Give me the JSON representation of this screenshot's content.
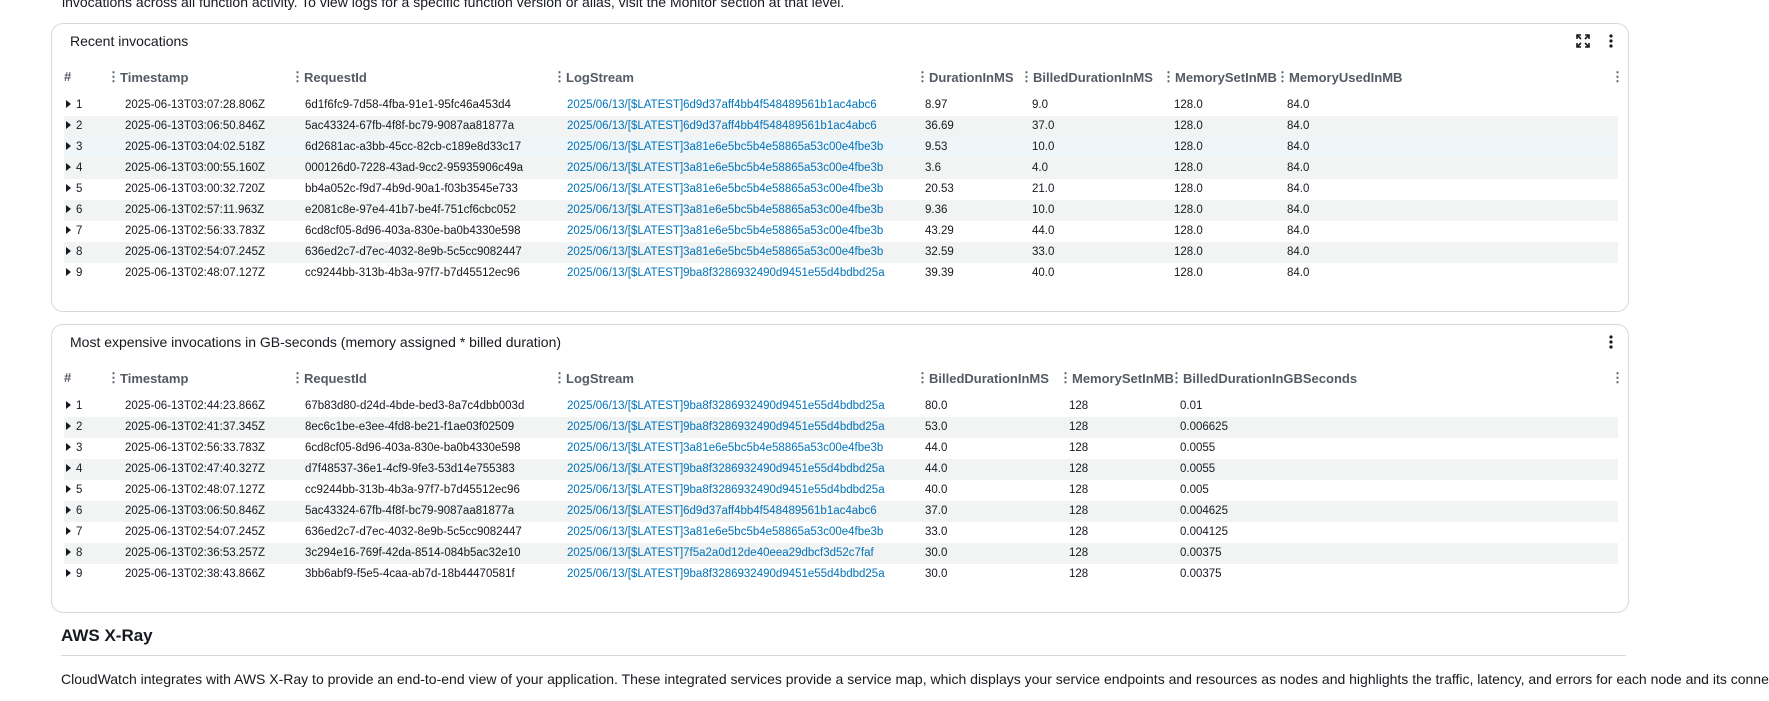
{
  "top_text": "invocations across all function activity. To view logs for a specific function version or alias, visit the Monitor section at that level.",
  "recent": {
    "title": "Recent invocations",
    "columns": [
      "#",
      "Timestamp",
      "RequestId",
      "LogStream",
      "DurationInMS",
      "BilledDurationInMS",
      "MemorySetInMB",
      "MemoryUsedInMB"
    ],
    "rows": [
      [
        "1",
        "2025-06-13T03:07:28.806Z",
        "6d1f6fc9-7d58-4fba-91e1-95fc46a453d4",
        "2025/06/13/[$LATEST]6d9d37aff4bb4f548489561b1ac4abc6",
        "8.97",
        "9.0",
        "128.0",
        "84.0"
      ],
      [
        "2",
        "2025-06-13T03:06:50.846Z",
        "5ac43324-67fb-4f8f-bc79-9087aa81877a",
        "2025/06/13/[$LATEST]6d9d37aff4bb4f548489561b1ac4abc6",
        "36.69",
        "37.0",
        "128.0",
        "84.0"
      ],
      [
        "3",
        "2025-06-13T03:04:02.518Z",
        "6d2681ac-a3bb-45cc-82cb-c189e8d33c17",
        "2025/06/13/[$LATEST]3a81e6e5bc5b4e58865a53c00e4fbe3b",
        "9.53",
        "10.0",
        "128.0",
        "84.0"
      ],
      [
        "4",
        "2025-06-13T03:00:55.160Z",
        "000126d0-7228-43ad-9cc2-95935906c49a",
        "2025/06/13/[$LATEST]3a81e6e5bc5b4e58865a53c00e4fbe3b",
        "3.6",
        "4.0",
        "128.0",
        "84.0"
      ],
      [
        "5",
        "2025-06-13T03:00:32.720Z",
        "bb4a052c-f9d7-4b9d-90a1-f03b3545e733",
        "2025/06/13/[$LATEST]3a81e6e5bc5b4e58865a53c00e4fbe3b",
        "20.53",
        "21.0",
        "128.0",
        "84.0"
      ],
      [
        "6",
        "2025-06-13T02:57:11.963Z",
        "e2081c8e-97e4-41b7-be4f-751cf6cbc052",
        "2025/06/13/[$LATEST]3a81e6e5bc5b4e58865a53c00e4fbe3b",
        "9.36",
        "10.0",
        "128.0",
        "84.0"
      ],
      [
        "7",
        "2025-06-13T02:56:33.783Z",
        "6cd8cf05-8d96-403a-830e-ba0b4330e598",
        "2025/06/13/[$LATEST]3a81e6e5bc5b4e58865a53c00e4fbe3b",
        "43.29",
        "44.0",
        "128.0",
        "84.0"
      ],
      [
        "8",
        "2025-06-13T02:54:07.245Z",
        "636ed2c7-d7ec-4032-8e9b-5c5cc9082447",
        "2025/06/13/[$LATEST]3a81e6e5bc5b4e58865a53c00e4fbe3b",
        "32.59",
        "33.0",
        "128.0",
        "84.0"
      ],
      [
        "9",
        "2025-06-13T02:48:07.127Z",
        "cc9244bb-313b-4b3a-97f7-b7d45512ec96",
        "2025/06/13/[$LATEST]9ba8f3286932490d9451e55d4bdbd25a",
        "39.39",
        "40.0",
        "128.0",
        "84.0"
      ]
    ]
  },
  "expensive": {
    "title": "Most expensive invocations in GB-seconds (memory assigned * billed duration)",
    "columns": [
      "#",
      "Timestamp",
      "RequestId",
      "LogStream",
      "BilledDurationInMS",
      "MemorySetInMB",
      "BilledDurationInGBSeconds"
    ],
    "rows": [
      [
        "1",
        "2025-06-13T02:44:23.866Z",
        "67b83d80-d24d-4bde-bed3-8a7c4dbb003d",
        "2025/06/13/[$LATEST]9ba8f3286932490d9451e55d4bdbd25a",
        "80.0",
        "128",
        "0.01"
      ],
      [
        "2",
        "2025-06-13T02:41:37.345Z",
        "8ec6c1be-e3ee-4fd8-be21-f1ae03f02509",
        "2025/06/13/[$LATEST]9ba8f3286932490d9451e55d4bdbd25a",
        "53.0",
        "128",
        "0.006625"
      ],
      [
        "3",
        "2025-06-13T02:56:33.783Z",
        "6cd8cf05-8d96-403a-830e-ba0b4330e598",
        "2025/06/13/[$LATEST]3a81e6e5bc5b4e58865a53c00e4fbe3b",
        "44.0",
        "128",
        "0.0055"
      ],
      [
        "4",
        "2025-06-13T02:47:40.327Z",
        "d7f48537-36e1-4cf9-9fe3-53d14e755383",
        "2025/06/13/[$LATEST]9ba8f3286932490d9451e55d4bdbd25a",
        "44.0",
        "128",
        "0.0055"
      ],
      [
        "5",
        "2025-06-13T02:48:07.127Z",
        "cc9244bb-313b-4b3a-97f7-b7d45512ec96",
        "2025/06/13/[$LATEST]9ba8f3286932490d9451e55d4bdbd25a",
        "40.0",
        "128",
        "0.005"
      ],
      [
        "6",
        "2025-06-13T03:06:50.846Z",
        "5ac43324-67fb-4f8f-bc79-9087aa81877a",
        "2025/06/13/[$LATEST]6d9d37aff4bb4f548489561b1ac4abc6",
        "37.0",
        "128",
        "0.004625"
      ],
      [
        "7",
        "2025-06-13T02:54:07.245Z",
        "636ed2c7-d7ec-4032-8e9b-5c5cc9082447",
        "2025/06/13/[$LATEST]3a81e6e5bc5b4e58865a53c00e4fbe3b",
        "33.0",
        "128",
        "0.004125"
      ],
      [
        "8",
        "2025-06-13T02:36:53.257Z",
        "3c294e16-769f-42da-8514-084b5ac32e10",
        "2025/06/13/[$LATEST]7f5a2a0d12de40eea29dbcf3d52c7faf",
        "30.0",
        "128",
        "0.00375"
      ],
      [
        "9",
        "2025-06-13T02:38:43.866Z",
        "3bb6abf9-f5e5-4caa-ab7d-18b44470581f",
        "2025/06/13/[$LATEST]9ba8f3286932490d9451e55d4bdbd25a",
        "30.0",
        "128",
        "0.00375"
      ]
    ]
  },
  "xray": {
    "title": "AWS X-Ray",
    "description": "CloudWatch integrates with AWS X-Ray to provide an end-to-end view of your application. These integrated services provide a service map, which displays your service endpoints and resources as nodes and highlights the traffic, latency, and errors for each node and its connections."
  },
  "icons": {
    "expand": "fullscreen-icon",
    "more": "more-vertical-icon",
    "expand_row": "caret-right-icon"
  },
  "colors": {
    "link": "#0073bb",
    "row_alt": "#f2f3f3",
    "row_highlight": "#eef6fa"
  }
}
